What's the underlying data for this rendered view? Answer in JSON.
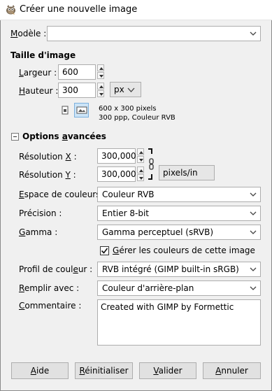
{
  "window": {
    "title": "Créer une nouvelle image",
    "icon": "gimp-icon"
  },
  "template": {
    "label_u": "M",
    "label_rest": "odèle :",
    "value": ""
  },
  "image_size": {
    "heading": "Taille d'image",
    "width_label_u": "L",
    "width_label_rest": "argeur :",
    "width_value": "600",
    "height_label_u": "H",
    "height_label_rest": "auteur :",
    "height_value": "300",
    "unit": "px",
    "info_line1": "600 x 300 pixels",
    "info_line2": "300 ppp, Couleur RVB"
  },
  "advanced": {
    "heading_pre": "Options ",
    "heading_u": "a",
    "heading_post": "vancées",
    "xres_label_pre": "Résolution ",
    "xres_label_u": "X",
    "xres_label_post": " :",
    "xres_value": "300,000",
    "yres_label_pre": "Résolution ",
    "yres_label_u": "Y",
    "yres_label_post": " :",
    "yres_value": "300,000",
    "res_unit": "pixels/in",
    "colorspace_label_u": "E",
    "colorspace_label_rest": "space de couleurs :",
    "colorspace_value": "Couleur RVB",
    "precision_label": "Précision :",
    "precision_value": "Entier 8-bit",
    "gamma_label_u": "G",
    "gamma_label_rest": "amma :",
    "gamma_value": "Gamma perceptuel (sRVB)",
    "manage_colors_label_u": "G",
    "manage_colors_label_rest": "érer les couleurs de cette image",
    "manage_colors_checked": true,
    "profile_label_pre": "Profil de coul",
    "profile_label_u": "e",
    "profile_label_post": "ur :",
    "profile_value": "RVB intégré (GIMP built-in sRGB)",
    "fill_label_u": "R",
    "fill_label_rest": "emplir avec :",
    "fill_value": "Couleur d'arrière-plan",
    "comment_label_u": "C",
    "comment_label_rest": "ommentaire :",
    "comment_value": "Created with GIMP by Formettic"
  },
  "buttons": {
    "help_u": "A",
    "help_rest": "ide",
    "reset_u": "R",
    "reset_rest": "éinitialiser",
    "ok_u": "V",
    "ok_rest": "alider",
    "cancel_u": "A",
    "cancel_rest": "nnuler"
  }
}
